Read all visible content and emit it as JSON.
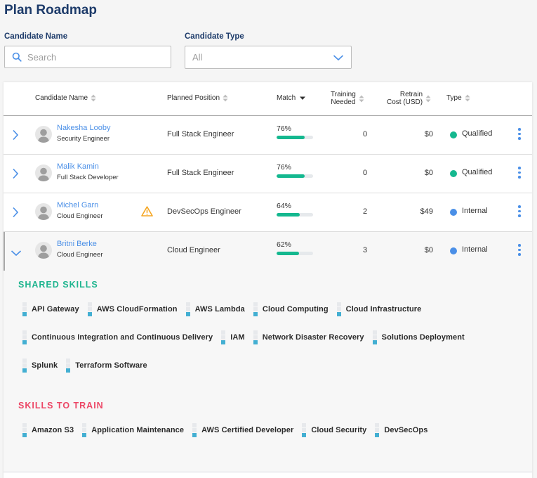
{
  "page": {
    "title": "Plan Roadmap"
  },
  "filters": {
    "candidate_name_label": "Candidate Name",
    "search_placeholder": "Search",
    "search_value": "",
    "candidate_type_label": "Candidate Type",
    "candidate_type_value": "All"
  },
  "table": {
    "columns": {
      "candidate_name": "Candidate Name",
      "planned_position": "Planned Position",
      "match": "Match",
      "training_line1": "Training",
      "training_line2": "Needed",
      "retrain_line1": "Retrain",
      "retrain_line2": "Cost (USD)",
      "type": "Type"
    },
    "sort": {
      "column": "match",
      "direction": "descending"
    },
    "rows": [
      {
        "name": "Nakesha Looby",
        "role": "Security Engineer",
        "warning": false,
        "position": "Full Stack Engineer",
        "match_pct": "76%",
        "match_value": 0.76,
        "training": "0",
        "cost": "$0",
        "type": "Qualified",
        "type_color": "#14b88f",
        "expanded": false
      },
      {
        "name": "Malik Kamin",
        "role": "Full Stack Developer",
        "warning": false,
        "position": "Full Stack Engineer",
        "match_pct": "76%",
        "match_value": 0.76,
        "training": "0",
        "cost": "$0",
        "type": "Qualified",
        "type_color": "#14b88f",
        "expanded": false
      },
      {
        "name": "Michel Garn",
        "role": "Cloud Engineer",
        "warning": true,
        "position": "DevSecOps Engineer",
        "match_pct": "64%",
        "match_value": 0.64,
        "training": "2",
        "cost": "$49",
        "type": "Internal",
        "type_color": "#4a8fe7",
        "expanded": false
      },
      {
        "name": "Britni Berke",
        "role": "Cloud Engineer",
        "warning": false,
        "position": "Cloud Engineer",
        "match_pct": "62%",
        "match_value": 0.62,
        "training": "3",
        "cost": "$0",
        "type": "Internal",
        "type_color": "#4a8fe7",
        "expanded": true
      }
    ]
  },
  "expanded": {
    "shared_title": "SHARED SKILLS",
    "shared_color": "#1fb58f",
    "shared_skills": [
      [
        "API Gateway",
        "AWS CloudFormation",
        "AWS Lambda",
        "Cloud Computing",
        "Cloud Infrastructure"
      ],
      [
        "Continuous Integration and Continuous Delivery",
        "IAM",
        "Network Disaster Recovery",
        "Solutions Deployment"
      ],
      [
        "Splunk",
        "Terraform Software"
      ]
    ],
    "train_title": "SKILLS TO TRAIN",
    "train_color": "#ec4766",
    "train_skills": [
      "Amazon S3",
      "Application Maintenance",
      "AWS Certified Developer",
      "Cloud Security",
      "DevSecOps"
    ],
    "skill_level": "1 of 3"
  },
  "colors": {
    "accent": "#4a8fe7",
    "title": "#1d3b6a",
    "match_bar": "#14b88f",
    "skill_bar": "#43afd2",
    "warning": "#f5a623"
  }
}
